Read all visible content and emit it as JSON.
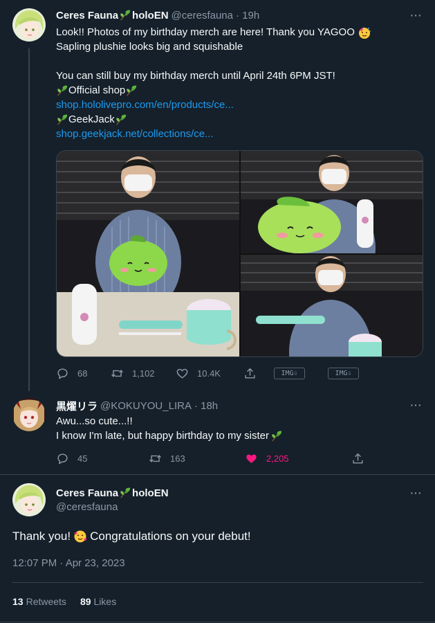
{
  "tweet1": {
    "display_name": "Ceres Fauna",
    "badge": "holoEN",
    "handle": "@ceresfauna",
    "time": "· 19h",
    "line1": "Look!! Photos of my birthday merch are here! Thank you YAGOO",
    "line2": "Sapling plushie looks big and squishable",
    "line3": "You can still buy my birthday merch until April 24th 6PM JST!",
    "shop1_label": "Official shop",
    "shop1_link": "shop.hololivepro.com/en/products/ce...",
    "shop2_label": "GeekJack",
    "shop2_link": "shop.geekjack.net/collections/ce...",
    "replies": "68",
    "retweets": "1,102",
    "likes": "10.4K",
    "img_btn_1": "IMG⇩",
    "img_btn_2": "IMG⇩"
  },
  "tweet2": {
    "display_name": "黒燿リラ",
    "handle": "@KOKUYOU_LIRA",
    "time": "· 18h",
    "line1": "Awu...so cute...!!",
    "line2": "I know I'm late, but happy birthday to my sister",
    "replies": "45",
    "retweets": "163",
    "likes": "2,205"
  },
  "tweet3": {
    "display_name": "Ceres Fauna",
    "badge": "holoEN",
    "handle": "@ceresfauna",
    "text_a": "Thank you!",
    "text_b": "Congratulations on your debut!",
    "timestamp": "12:07 PM · Apr 23, 2023",
    "retweets_count": "13",
    "retweets_label": "Retweets",
    "likes_count": "89",
    "likes_label": "Likes"
  },
  "more_glyph": "···",
  "colors": {
    "background": "#15202b",
    "accent": "#1d9bf0",
    "like_active": "#f91880",
    "muted": "#8b98a5",
    "border": "#38444d"
  },
  "icons": [
    "reply-icon",
    "retweet-icon",
    "like-icon",
    "share-icon",
    "leaf-emoji-icon",
    "partying-face-icon",
    "smiling-hearts-icon",
    "more-icon"
  ]
}
